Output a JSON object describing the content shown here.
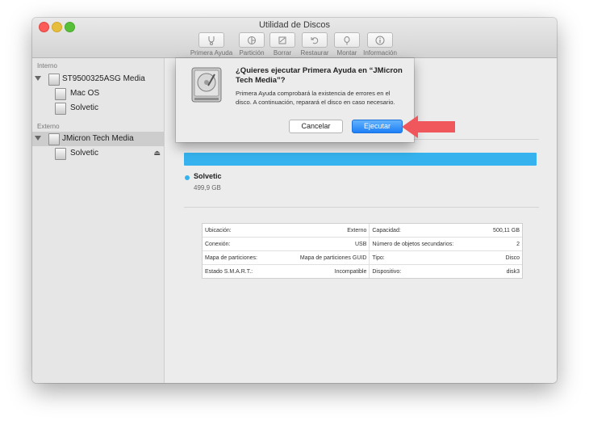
{
  "window": {
    "title": "Utilidad de Discos"
  },
  "toolbar": [
    {
      "label": "Primera Ayuda",
      "icon": "stethoscope-icon"
    },
    {
      "label": "Partición",
      "icon": "partition-icon"
    },
    {
      "label": "Borrar",
      "icon": "erase-icon"
    },
    {
      "label": "Restaurar",
      "icon": "restore-icon"
    },
    {
      "label": "Montar",
      "icon": "mount-icon"
    },
    {
      "label": "Información",
      "icon": "info-icon"
    }
  ],
  "sidebar": {
    "internal_label": "Interno",
    "external_label": "Externo",
    "internal_disk": "ST9500325ASG Media",
    "internal_volumes": [
      "Mac OS",
      "Solvetic"
    ],
    "external_disk": "JMicron Tech Media",
    "external_volumes": [
      "Solvetic"
    ]
  },
  "main": {
    "usage": {
      "name": "Solvetic",
      "size": "499,9 GB",
      "color": "#36b3ee"
    },
    "info": [
      {
        "k1": "Ubicación:",
        "v1": "Externo",
        "k2": "Capacidad:",
        "v2": "500,11 GB"
      },
      {
        "k1": "Conexión:",
        "v1": "USB",
        "k2": "Número de objetos secundarios:",
        "v2": "2"
      },
      {
        "k1": "Mapa de particiones:",
        "v1": "Mapa de particiones GUID",
        "k2": "Tipo:",
        "v2": "Disco"
      },
      {
        "k1": "Estado S.M.A.R.T.:",
        "v1": "Incompatible",
        "k2": "Dispositivo:",
        "v2": "disk3"
      }
    ]
  },
  "dialog": {
    "title": "¿Quieres ejecutar Primera Ayuda en “JMicron Tech Media”?",
    "message": "Primera Ayuda comprobará la existencia de errores en el disco. A continuación, reparará el disco en caso necesario.",
    "cancel_label": "Cancelar",
    "run_label": "Ejecutar"
  },
  "colors": {
    "accent": "#36b3ee",
    "arrow": "#f0575c",
    "primary_button": "#1e7ff7"
  }
}
